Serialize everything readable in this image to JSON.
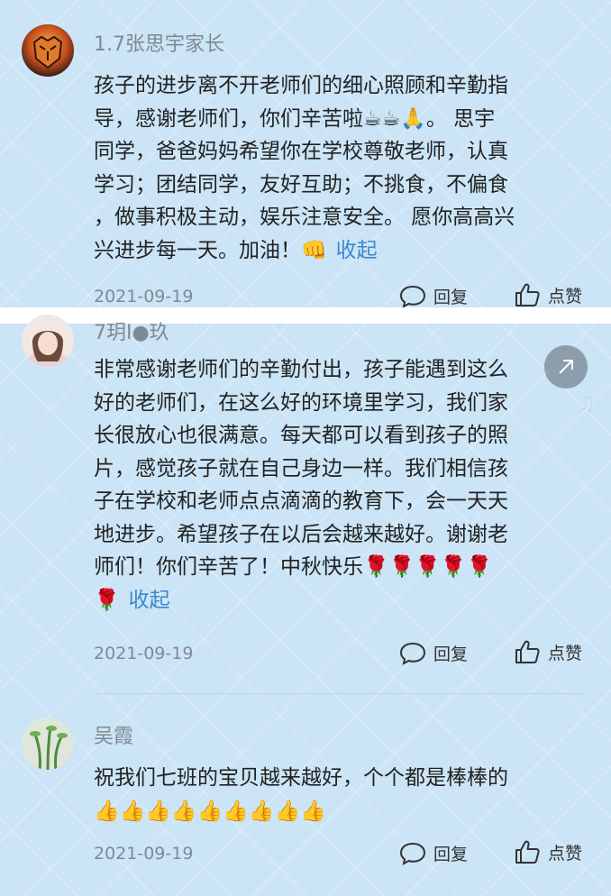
{
  "comments": [
    {
      "username": "1.7张思宇家长",
      "lines": [
        "孩子的进步离不开老师们的细心照顾和辛勤指",
        "导，感谢老师们，你们辛苦啦☕☕🙏。 思宇",
        "同学，爸爸妈妈希望你在学校尊敬老师，认真",
        "学习；团结同学，友好互助；不挑食，不偏食",
        "，做事积极主动，娱乐注意安全。 愿你高高兴",
        "兴进步每一天。加油！👊"
      ],
      "collapse_label": "收起",
      "date": "2021-09-19",
      "reply_label": "回复",
      "like_label": "点赞"
    },
    {
      "username": "7玥I●玖",
      "lines": [
        "非常感谢老师们的辛勤付出，孩子能遇到这么",
        "好的老师们，在这么好的环境里学习，我们家",
        "长很放心也很满意。每天都可以看到孩子的照",
        "片，感觉孩子就在自己身边一样。我们相信孩",
        "子在学校和老师点点滴滴的教育下，会一天天",
        "地进步。希望孩子在以后会越来越好。谢谢老",
        "师们！你们辛苦了！中秋快乐🌹🌹🌹🌹🌹",
        "🌹"
      ],
      "collapse_label": "收起",
      "date": "2021-09-19",
      "reply_label": "回复",
      "like_label": "点赞"
    },
    {
      "username": "吴霞",
      "lines": [
        "祝我们七班的宝贝越来越好，个个都是棒棒的",
        "👍👍👍👍👍👍👍👍👍"
      ],
      "date": "2021-09-19",
      "reply_label": "回复",
      "like_label": "点赞"
    }
  ],
  "icons": {
    "reply": "comment-bubble-icon",
    "like": "thumbs-up-icon",
    "float": "back-to-top-icon",
    "music": "music-note-icon"
  },
  "colors": {
    "background": "#cbe4f6",
    "username": "#7f8a93",
    "link": "#3e86cf"
  }
}
